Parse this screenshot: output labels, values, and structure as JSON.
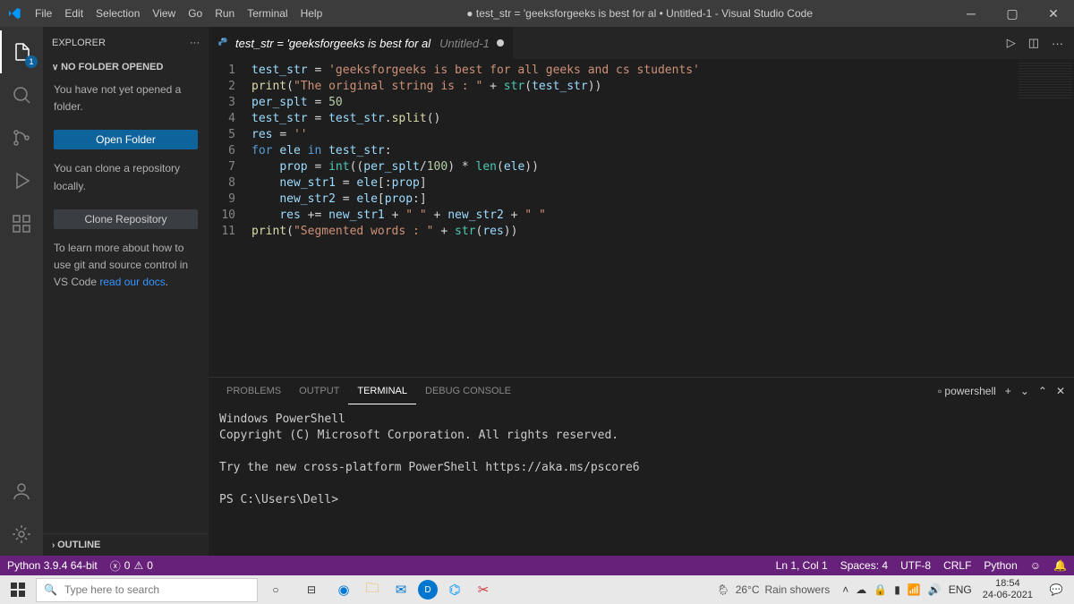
{
  "titlebar": {
    "menus": [
      "File",
      "Edit",
      "Selection",
      "View",
      "Go",
      "Run",
      "Terminal",
      "Help"
    ],
    "title": "● test_str = 'geeksforgeeks is best for al • Untitled-1 - Visual Studio Code"
  },
  "sidebar": {
    "header": "EXPLORER",
    "section_label": "NO FOLDER OPENED",
    "msg1": "You have not yet opened a folder.",
    "open_folder": "Open Folder",
    "msg2": "You can clone a repository locally.",
    "clone_repo": "Clone Repository",
    "msg3a": "To learn more about how to use git and source control in VS Code ",
    "msg3_link": "read our docs",
    "msg3b": ".",
    "outline": "OUTLINE"
  },
  "tab": {
    "filename": "test_str = 'geeksforgeeks is best for al",
    "second": "Untitled-1"
  },
  "code": {
    "lines": [
      {
        "n": 1,
        "html": "<span class='vr'>test_str</span> <span class='pun'>=</span> <span class='str'>'geeksforgeeks is best for all geeks and cs students'</span>"
      },
      {
        "n": 2,
        "html": "<span class='fn'>print</span>(<span class='str'>\"The original string is : \"</span> <span class='pun'>+</span> <span class='bi'>str</span>(<span class='vr'>test_str</span>))"
      },
      {
        "n": 3,
        "html": "<span class='vr'>per_splt</span> <span class='pun'>=</span> <span class='num'>50</span>"
      },
      {
        "n": 4,
        "html": "<span class='vr'>test_str</span> <span class='pun'>=</span> <span class='vr'>test_str</span>.<span class='fn'>split</span>()"
      },
      {
        "n": 5,
        "html": "<span class='vr'>res</span> <span class='pun'>=</span> <span class='str'>''</span>"
      },
      {
        "n": 6,
        "html": "<span class='kw'>for</span> <span class='vr'>ele</span> <span class='kw'>in</span> <span class='vr'>test_str</span>:"
      },
      {
        "n": 7,
        "html": "    <span class='vr'>prop</span> <span class='pun'>=</span> <span class='bi'>int</span>((<span class='vr'>per_splt</span><span class='pun'>/</span><span class='num'>100</span>) <span class='pun'>*</span> <span class='bi'>len</span>(<span class='vr'>ele</span>))"
      },
      {
        "n": 8,
        "html": "    <span class='vr'>new_str1</span> <span class='pun'>=</span> <span class='vr'>ele</span>[:<span class='vr'>prop</span>]"
      },
      {
        "n": 9,
        "html": "    <span class='vr'>new_str2</span> <span class='pun'>=</span> <span class='vr'>ele</span>[<span class='vr'>prop</span>:]"
      },
      {
        "n": 10,
        "html": "    <span class='vr'>res</span> <span class='pun'>+=</span> <span class='vr'>new_str1</span> <span class='pun'>+</span> <span class='str'>\" \"</span> <span class='pun'>+</span> <span class='vr'>new_str2</span> <span class='pun'>+</span> <span class='str'>\" \"</span>"
      },
      {
        "n": 11,
        "html": "<span class='fn'>print</span>(<span class='str'>\"Segmented words : \"</span> <span class='pun'>+</span> <span class='bi'>str</span>(<span class='vr'>res</span>))"
      }
    ]
  },
  "panel": {
    "tabs": [
      "PROBLEMS",
      "OUTPUT",
      "TERMINAL",
      "DEBUG CONSOLE"
    ],
    "active": 2,
    "shell_label": "powershell",
    "lines": [
      "Windows PowerShell",
      "Copyright (C) Microsoft Corporation. All rights reserved.",
      "",
      "Try the new cross-platform PowerShell https://aka.ms/pscore6",
      "",
      "PS C:\\Users\\Dell>"
    ]
  },
  "statusbar": {
    "python": "Python 3.9.4 64-bit",
    "errors": "0",
    "warnings": "0",
    "ln_col": "Ln 1, Col 1",
    "spaces": "Spaces: 4",
    "encoding": "UTF-8",
    "eol": "CRLF",
    "lang": "Python"
  },
  "taskbar": {
    "search_placeholder": "Type here to search",
    "weather_temp": "26°C",
    "weather_desc": "Rain showers",
    "lang": "ENG",
    "time": "18:54",
    "date": "24-06-2021"
  }
}
